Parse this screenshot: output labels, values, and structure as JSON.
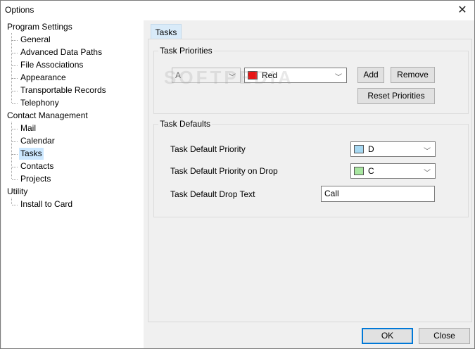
{
  "window": {
    "title": "Options"
  },
  "tree": {
    "groups": [
      {
        "label": "Program Settings",
        "children": [
          "General",
          "Advanced Data Paths",
          "File Associations",
          "Appearance",
          "Transportable Records",
          "Telephony"
        ]
      },
      {
        "label": "Contact Management",
        "children": [
          "Mail",
          "Calendar",
          "Tasks",
          "Contacts",
          "Projects"
        ]
      },
      {
        "label": "Utility",
        "children": [
          "Install to Card"
        ]
      }
    ],
    "selected": "Tasks"
  },
  "tab": {
    "label": "Tasks"
  },
  "priorities": {
    "group_title": "Task Priorities",
    "letter_value": "A",
    "color_value": "Red",
    "color_hex": "#e81414",
    "add_label": "Add",
    "remove_label": "Remove",
    "reset_label": "Reset Priorities"
  },
  "defaults": {
    "group_title": "Task Defaults",
    "priority_label": "Task Default Priority",
    "priority_value": "D",
    "priority_color": "#a6d8f2",
    "drop_priority_label": "Task Default Priority on Drop",
    "drop_priority_value": "C",
    "drop_priority_color": "#a8e6a0",
    "drop_text_label": "Task Default Drop Text",
    "drop_text_value": "Call"
  },
  "footer": {
    "ok_label": "OK",
    "close_label": "Close"
  },
  "watermark": "SOFTPEDIA"
}
